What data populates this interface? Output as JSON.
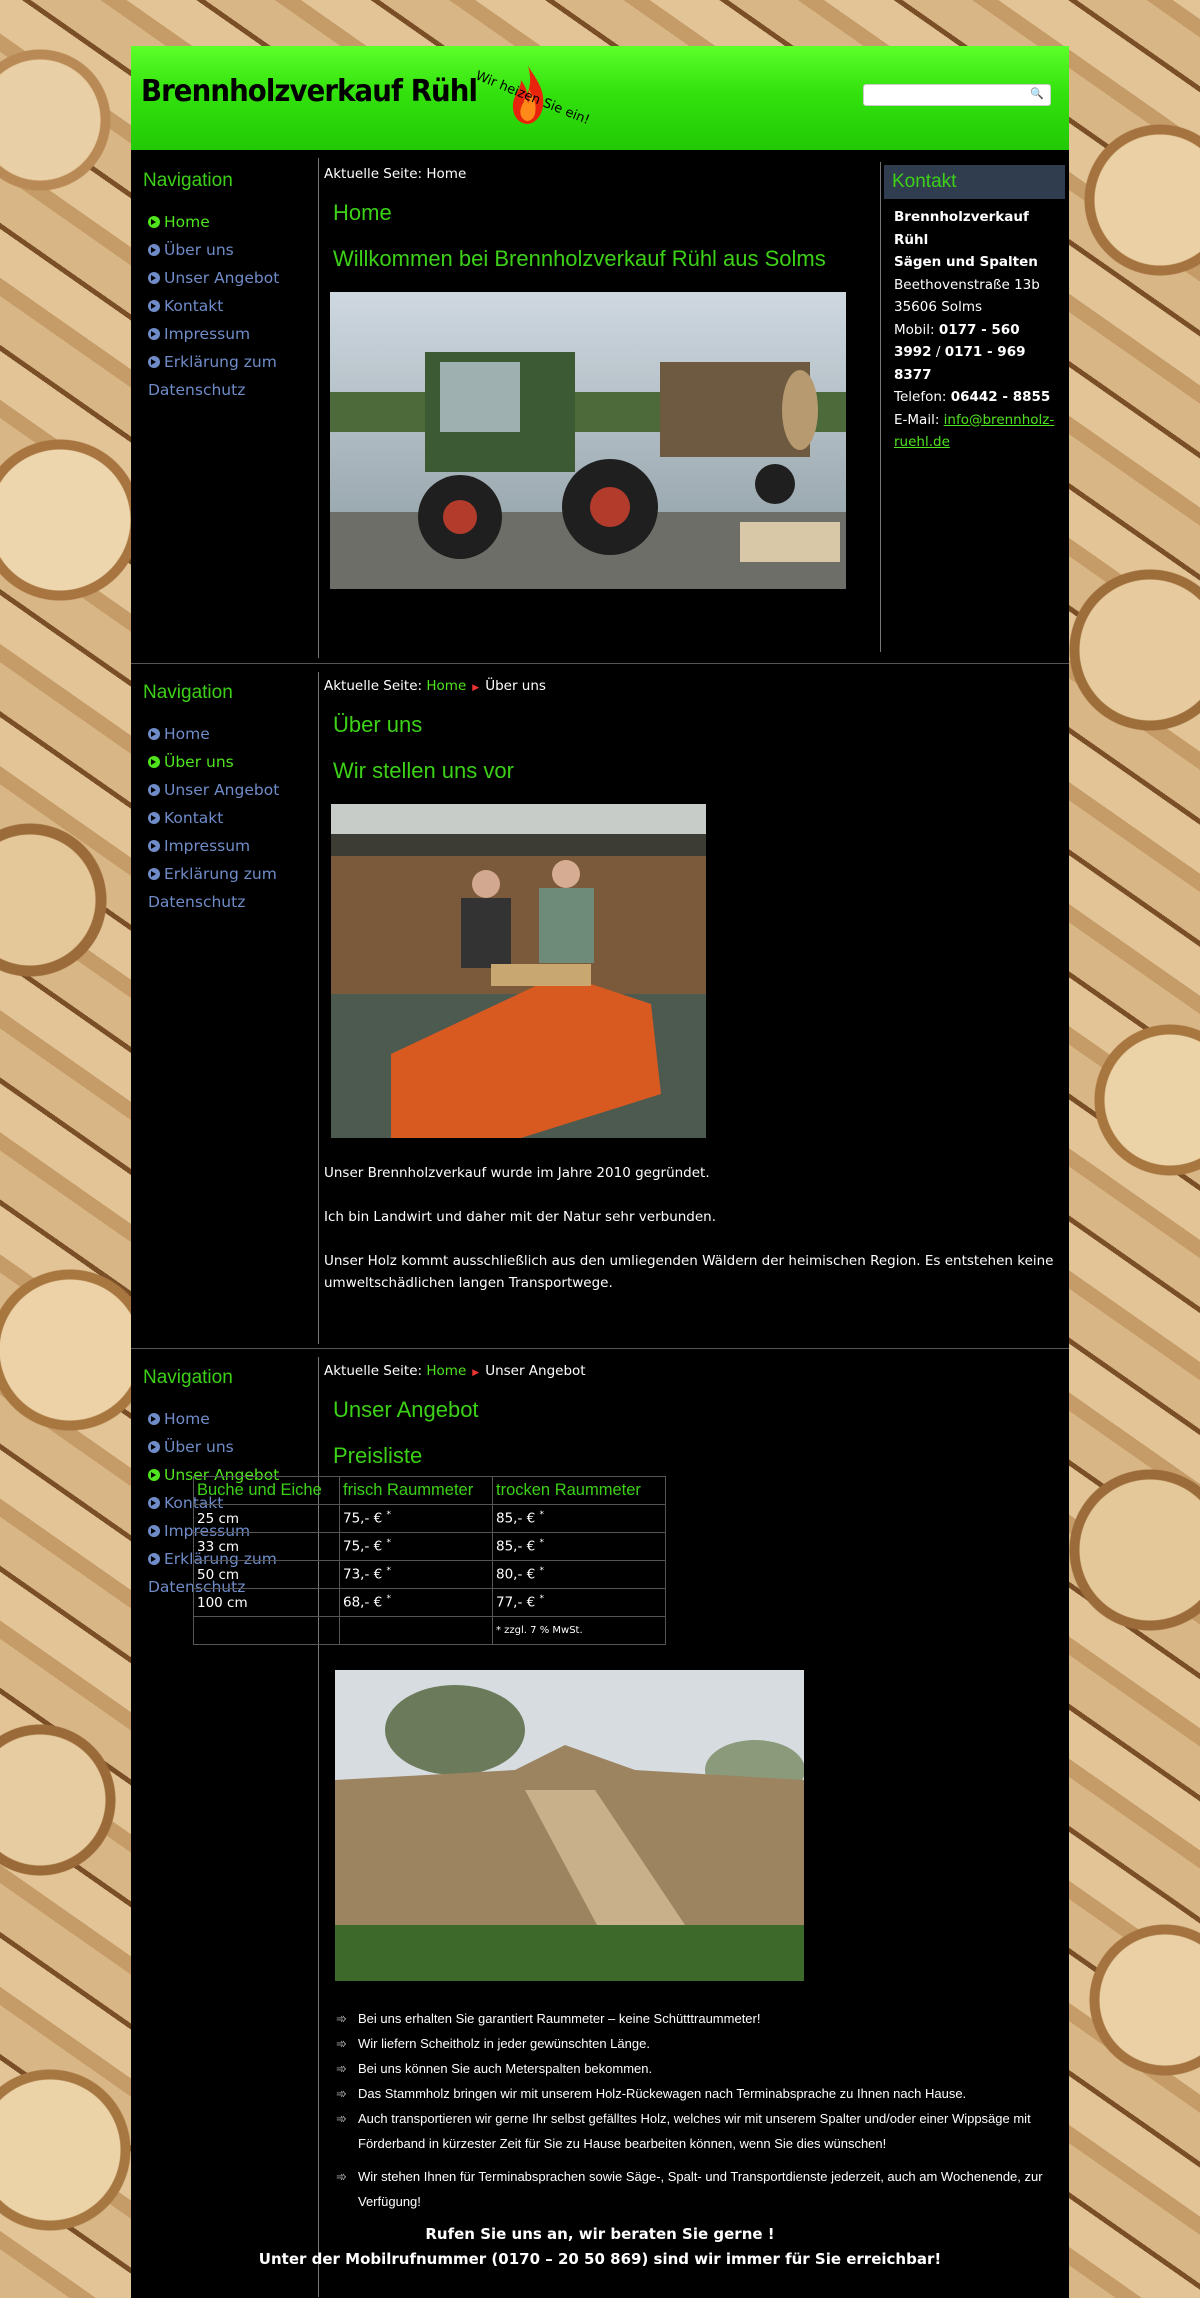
{
  "header": {
    "logo": "Brennholzverkauf Rühl",
    "slogan": "Wir heizen Sie ein!",
    "search_placeholder": ""
  },
  "sections": [
    {
      "crumb_prefix": "Aktuelle Seite:",
      "crumb_home": "",
      "crumb_current": "Home",
      "title": "Home",
      "subtitle": "Willkommen bei Brennholzverkauf Rühl aus Solms"
    },
    {
      "crumb_prefix": "Aktuelle Seite:",
      "crumb_home": "Home",
      "crumb_current": "Über uns",
      "title": "Über uns",
      "subtitle": "Wir stellen uns vor"
    },
    {
      "crumb_prefix": "Aktuelle Seite:",
      "crumb_home": "Home",
      "crumb_current": "Unser Angebot",
      "title": "Unser Angebot",
      "subtitle": "Preisliste"
    }
  ],
  "nav": {
    "title": "Navigation",
    "items": [
      "Home",
      "Über uns",
      "Unser Angebot",
      "Kontakt",
      "Impressum",
      "Erklärung zum",
      "Datenschutz"
    ]
  },
  "kontakt": {
    "title": "Kontakt",
    "name1": "Brennholzverkauf",
    "name2": "Rühl",
    "name3": "Sägen und Spalten",
    "street": "Beethovenstraße 13b",
    "city": "35606 Solms",
    "mobil_label": "Mobil:",
    "mobil1": "0177 - 560",
    "mobil2": "3992",
    "mobil_sep": "/",
    "mobil3": "0171 - 969",
    "mobil4": "8377",
    "tel_label": "Telefon:",
    "tel": "06442 - 8855",
    "mail_label": "E-Mail:",
    "mail1": "info@brennholz-",
    "mail2": "ruehl.de"
  },
  "ueber": {
    "p1": "Unser Brennholzverkauf wurde im Jahre 2010 gegründet.",
    "p2": "Ich bin Landwirt und daher mit der Natur sehr verbunden.",
    "p3a": "Unser Holz kommt ausschließlich aus den umliegenden Wäldern der heimischen Region.  Es entstehen keine",
    "p3b": "umweltschädlichen langen Transportwege."
  },
  "prices": {
    "headers": [
      "Buche und Eiche",
      "frisch Raummeter",
      "trocken Raummeter"
    ],
    "rows": [
      [
        "25 cm",
        "75,- €",
        "85,- €"
      ],
      [
        "33 cm",
        "75,- €",
        "85,- €"
      ],
      [
        "50 cm",
        "73,- €",
        "80,- €"
      ],
      [
        "100 cm",
        "68,- €",
        "77,- €"
      ]
    ],
    "star": "*",
    "note": "* zzgl. 7 % MwSt."
  },
  "bullets": [
    "Bei uns erhalten Sie garantiert Raummeter – keine Schütttraummeter!",
    "Wir liefern Scheitholz in jeder gewünschten Länge.",
    "Bei uns können Sie auch Meterspalten bekommen.",
    "Das Stammholz bringen wir  mit unserem Holz-Rückewagen nach Terminabsprache zu Ihnen nach Hause.",
    "Auch transportieren wir gerne Ihr selbst gefälltes Holz, welches wir mit unserem Spalter und/oder einer Wippsäge mit",
    "Förderband  in kürzester Zeit  für Sie zu Hause bearbeiten können, wenn Sie dies wünschen!",
    "Wir stehen Ihnen für Terminabsprachen sowie Säge-, Spalt- und Transportdienste jederzeit, auch am Wochenende, zur",
    "Verfügung!"
  ],
  "cta": {
    "line1": "Rufen Sie uns an, wir beraten Sie gerne !",
    "line2": "Unter der Mobilrufnummer (0170 – 20 50 869) sind wir immer für Sie erreichbar!"
  }
}
